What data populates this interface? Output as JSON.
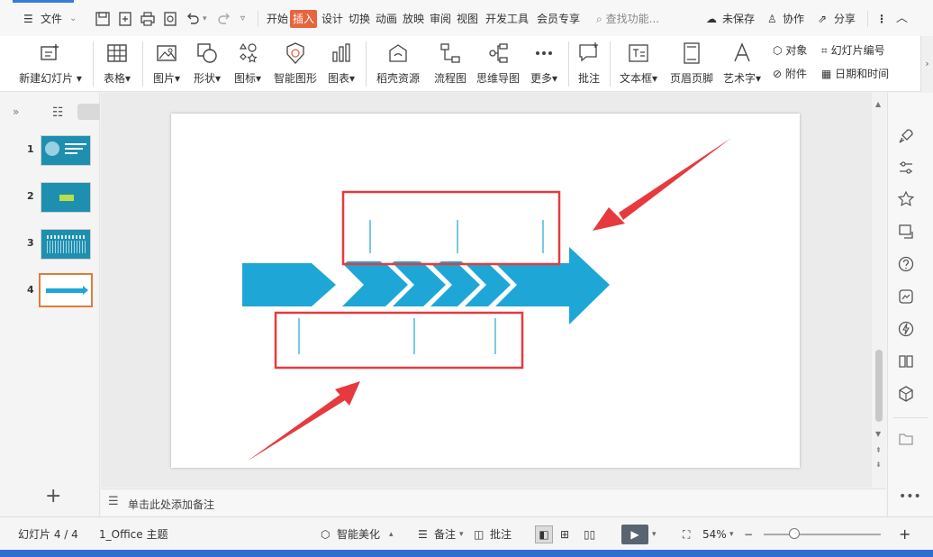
{
  "topbar": {
    "file_label": "文件",
    "tabs": [
      {
        "label": "开始",
        "active": false
      },
      {
        "label": "插入",
        "active": true
      },
      {
        "label": "设计",
        "active": false
      },
      {
        "label": "切换",
        "active": false
      },
      {
        "label": "动画",
        "active": false
      },
      {
        "label": "放映",
        "active": false
      },
      {
        "label": "审阅",
        "active": false
      },
      {
        "label": "视图",
        "active": false
      },
      {
        "label": "开发工具",
        "active": false
      },
      {
        "label": "会员专享",
        "active": false
      }
    ],
    "search_placeholder": "查找功能...",
    "unsaved_label": "未保存",
    "collab_label": "协作",
    "share_label": "分享",
    "accent_color": "#e8643c"
  },
  "ribbon": {
    "new_slide": "新建幻灯片",
    "table": "表格",
    "picture": "图片",
    "shape": "形状",
    "icon": "图标",
    "smart_shape": "智能图形",
    "chart": "图表",
    "resources": "稻壳资源",
    "flowchart": "流程图",
    "mindmap": "思维导图",
    "more": "更多",
    "comment": "批注",
    "textbox": "文本框",
    "header_footer": "页眉页脚",
    "wordart": "艺术字",
    "object": "对象",
    "slide_number": "幻灯片编号",
    "attachment": "附件",
    "datetime": "日期和时间"
  },
  "slides": [
    {
      "number": "1"
    },
    {
      "number": "2"
    },
    {
      "number": "3"
    },
    {
      "number": "4"
    }
  ],
  "slide_colors": {
    "arrow": "#1ea7d6",
    "box": "#e63a3f",
    "pointer": "#e63a3f"
  },
  "notes_placeholder": "单击此处添加备注",
  "status": {
    "slide_counter": "幻灯片 4 / 4",
    "theme": "1_Office 主题",
    "beautify": "智能美化",
    "notes": "备注",
    "comment": "批注",
    "zoom": "54%"
  }
}
